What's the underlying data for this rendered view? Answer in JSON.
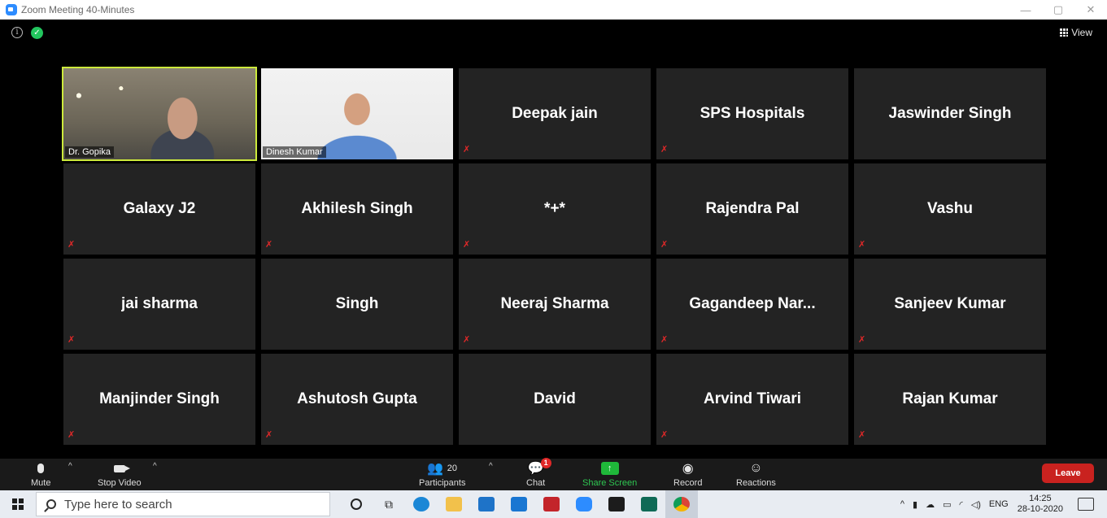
{
  "window": {
    "title": "Zoom Meeting 40-Minutes",
    "min": "—",
    "max": "▢",
    "close": "✕"
  },
  "top_bar": {
    "info_glyph": "i",
    "shield_glyph": "✓",
    "view_label": "View"
  },
  "participants": [
    {
      "name": "Dr. Gopika",
      "video": true,
      "active_speaker": true
    },
    {
      "name": "Dinesh Kumar",
      "video": true
    },
    {
      "name": "Deepak jain",
      "muted": true
    },
    {
      "name": "SPS Hospitals",
      "muted": true
    },
    {
      "name": "Jaswinder Singh",
      "muted": false
    },
    {
      "name": "Galaxy J2",
      "muted": true
    },
    {
      "name": "Akhilesh Singh",
      "muted": true
    },
    {
      "name": "*+*",
      "muted": true
    },
    {
      "name": "Rajendra Pal",
      "muted": true
    },
    {
      "name": "Vashu",
      "muted": true
    },
    {
      "name": "jai sharma",
      "muted": true
    },
    {
      "name": "Singh",
      "muted": false
    },
    {
      "name": "Neeraj Sharma",
      "muted": true
    },
    {
      "name": "Gagandeep  Nar...",
      "muted": true
    },
    {
      "name": "Sanjeev Kumar",
      "muted": true
    },
    {
      "name": "Manjinder Singh",
      "muted": true
    },
    {
      "name": "Ashutosh Gupta",
      "muted": true
    },
    {
      "name": "David",
      "muted": false
    },
    {
      "name": "Arvind Tiwari",
      "muted": true
    },
    {
      "name": "Rajan Kumar",
      "muted": true
    }
  ],
  "controls": {
    "mute": "Mute",
    "stop_video": "Stop Video",
    "participants": "Participants",
    "participant_count": "20",
    "chat": "Chat",
    "chat_badge": "1",
    "share_screen": "Share Screen",
    "record": "Record",
    "reactions": "Reactions",
    "leave": "Leave",
    "caret": "^"
  },
  "taskbar": {
    "search_placeholder": "Type here to search",
    "tray_lang": "ENG",
    "time": "14:25",
    "date": "28-10-2020"
  },
  "colors": {
    "active_speaker_border": "#cdea3c",
    "muted_icon": "#e02828",
    "share_green": "#1fb83a",
    "leave_red": "#c9221f",
    "tile_bg": "#232323"
  }
}
